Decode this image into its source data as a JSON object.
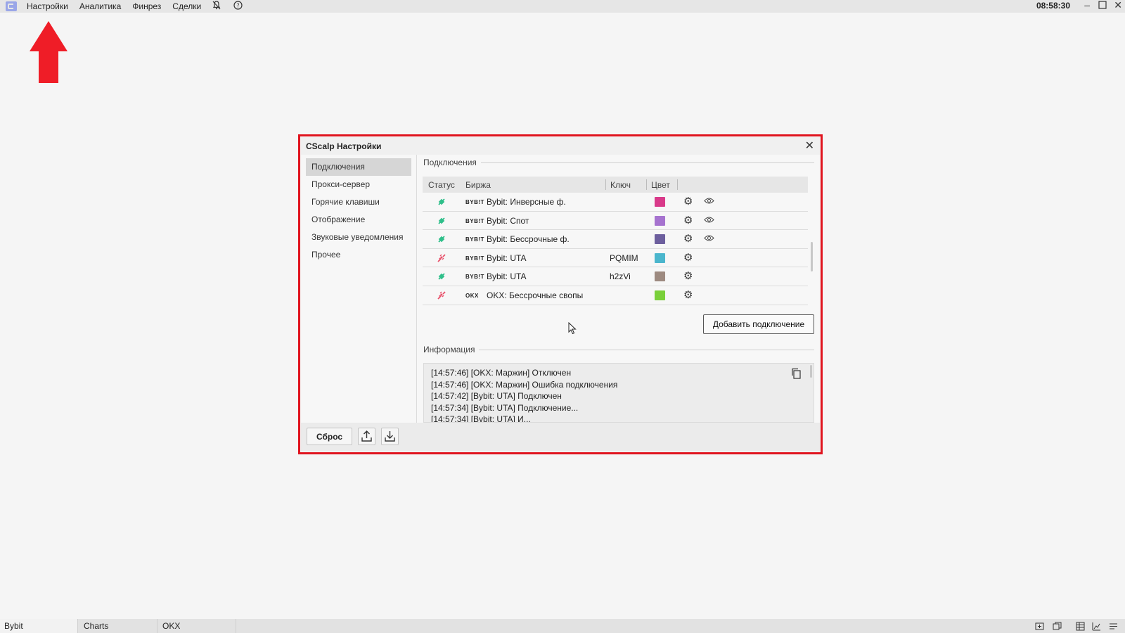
{
  "menubar": {
    "items": [
      "Настройки",
      "Аналитика",
      "Финрез",
      "Сделки"
    ],
    "clock": "08:58:30",
    "icons": [
      "app-logo-icon",
      "mute-icon",
      "help-icon",
      "minimize-icon",
      "maximize-icon",
      "close-icon"
    ]
  },
  "dialog": {
    "title": "CScalp Настройки",
    "nav": [
      "Подключения",
      "Прокси-сервер",
      "Горячие клавиши",
      "Отображение",
      "Звуковые уведомления",
      "Прочее"
    ],
    "active_nav": "Подключения",
    "connections_label": "Подключения",
    "columns": {
      "status": "Статус",
      "exchange": "Биржа",
      "key": "Ключ",
      "color": "Цвет"
    },
    "rows": [
      {
        "status": "connected",
        "logo": "BYB!T",
        "name": "Bybit: Инверсные ф.",
        "key": "",
        "color": "#d93a8a",
        "eye": true
      },
      {
        "status": "connected",
        "logo": "BYB!T",
        "name": "Bybit: Спот",
        "key": "",
        "color": "#a673cf",
        "eye": true
      },
      {
        "status": "connected",
        "logo": "BYB!T",
        "name": "Bybit: Бессрочные ф.",
        "key": "",
        "color": "#6d5f9e",
        "eye": true
      },
      {
        "status": "disconnected",
        "logo": "BYB!T",
        "name": "Bybit: UTA",
        "key": "PQMIM",
        "color": "#4bb6cd",
        "eye": false
      },
      {
        "status": "connected",
        "logo": "BYB!T",
        "name": "Bybit: UTA",
        "key": "h2zVi",
        "color": "#9d8a80",
        "eye": false
      },
      {
        "status": "disconnected",
        "logo": "OKX",
        "name": "OKX: Бессрочные свопы",
        "key": "",
        "color": "#7ad03a",
        "eye": false
      }
    ],
    "add_button": "Добавить подключение",
    "info_label": "Информация",
    "log": [
      "[14:57:46] [OKX: Маржин] Отключен",
      "[14:57:46] [OKX: Маржин] Ошибка подключения",
      "[14:57:42] [Bybit: UTA] Подключен",
      "[14:57:34] [Bybit: UTA] Подключение...",
      "[14:57:34] [Bybit: UTA] И..."
    ],
    "reset_button": "Сброс"
  },
  "bottombar": {
    "tabs": [
      "Bybit",
      "Charts",
      "OKX"
    ]
  },
  "colors": {
    "highlight_red": "#e0141e",
    "connected_green": "#2fbf8a",
    "disconnected_red": "#e8506a"
  }
}
